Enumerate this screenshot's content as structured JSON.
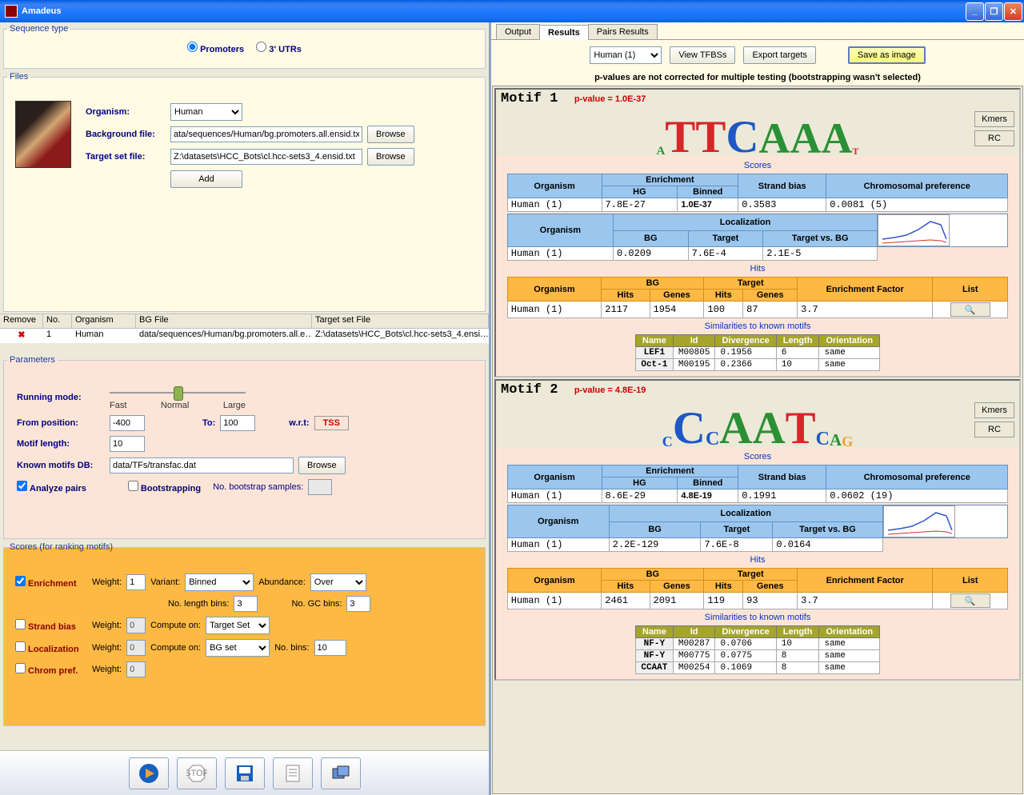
{
  "title": "Amadeus",
  "seqtype": {
    "legend": "Sequence type",
    "promoters": "Promoters",
    "utrs": "3' UTRs"
  },
  "files": {
    "legend": "Files",
    "organism_lbl": "Organism:",
    "organism_val": "Human",
    "bgfile_lbl": "Background file:",
    "bgfile_val": "ata/sequences/Human/bg.promoters.all.ensid.txt",
    "tgtfile_lbl": "Target set file:",
    "tgtfile_val": "Z:\\datasets\\HCC_Bots\\cl.hcc-sets3_4.ensid.txt",
    "browse": "Browse",
    "add": "Add"
  },
  "ftable": {
    "h": [
      "Remove",
      "No.",
      "Organism",
      "BG File",
      "Target set File"
    ],
    "row": [
      "",
      "1",
      "Human",
      "data/sequences/Human/bg.promoters.all.e…",
      "Z:\\datasets\\HCC_Bots\\cl.hcc-sets3_4.ensi…"
    ]
  },
  "params": {
    "legend": "Parameters",
    "runmode": "Running mode:",
    "fast": "Fast",
    "normal": "Normal",
    "large": "Large",
    "frompos": "From position:",
    "frompos_v": "-400",
    "to": "To:",
    "to_v": "100",
    "wrt": "w.r.t:",
    "tss": "TSS",
    "motiflen": "Motif length:",
    "motiflen_v": "10",
    "knownDB": "Known motifs DB:",
    "knownDB_v": "data/TFs/transfac.dat",
    "browse": "Browse",
    "analyze": "Analyze pairs",
    "boot": "Bootstrapping",
    "bootsamp": "No. bootstrap samples:"
  },
  "scores": {
    "legend": "Scores (for ranking motifs)",
    "enr": "Enrichment",
    "weight": "Weight:",
    "variant": "Variant:",
    "binned": "Binned",
    "abund": "Abundance:",
    "over": "Over",
    "nlen": "No. length bins:",
    "ngc": "No. GC bins:",
    "three": "3",
    "strand": "Strand bias",
    "compute": "Compute on:",
    "tgtset": "Target Set",
    "local": "Localization",
    "bgset": "BG set",
    "nobins": "No. bins:",
    "ten": "10",
    "chrom": "Chrom pref.",
    "w1": "1",
    "w0": "0"
  },
  "tabs": {
    "output": "Output",
    "results": "Results",
    "pairs": "Pairs Results"
  },
  "actions": {
    "human": "Human (1)",
    "viewtfbs": "View TFBSs",
    "export": "Export targets",
    "save": "Save as image"
  },
  "note": "p-values are not corrected for multiple testing (bootstrapping wasn't selected)",
  "motifs": [
    {
      "hdr": "Motif 1",
      "pval": "p-value = 1.0E-37",
      "logo": [
        {
          "c": "A",
          "h": 0.25,
          "col": "cA"
        },
        {
          "c": "T",
          "h": 0.95,
          "col": "cT"
        },
        {
          "c": "T",
          "h": 0.95,
          "col": "cT"
        },
        {
          "c": "C",
          "h": 0.95,
          "col": "cC"
        },
        {
          "c": "A",
          "h": 0.9,
          "col": "cA"
        },
        {
          "c": "A",
          "h": 0.9,
          "col": "cA"
        },
        {
          "c": "A",
          "h": 0.9,
          "col": "cA"
        },
        {
          "c": "T",
          "h": 0.2,
          "col": "cT"
        }
      ],
      "scores_lbl": "Scores",
      "enr": {
        "org": "Human (1)",
        "hg": "7.8E-27",
        "binned": "1.0E-37",
        "strand": "0.3583",
        "chrom": "0.0081 (5)"
      },
      "loc": {
        "org": "Human (1)",
        "bg": "0.0209",
        "tgt": "7.6E-4",
        "tvb": "2.1E-5"
      },
      "hits_lbl": "Hits",
      "hits": {
        "org": "Human (1)",
        "bghits": "2117",
        "bggenes": "1954",
        "tgthits": "100",
        "tgtgenes": "87",
        "ef": "3.7"
      },
      "sim_lbl": "Similarities to known motifs",
      "sim": [
        [
          "LEF1",
          "M00805",
          "0.1956",
          "6",
          "same"
        ],
        [
          "Oct-1",
          "M00195",
          "0.2366",
          "10",
          "same"
        ]
      ],
      "simh": [
        "Name",
        "Id",
        "Divergence",
        "Length",
        "Orientation"
      ],
      "kmers": "Kmers",
      "rc": "RC",
      "list": "List"
    },
    {
      "hdr": "Motif 2",
      "pval": "p-value = 4.8E-19",
      "logo": [
        {
          "c": "C",
          "h": 0.3,
          "col": "cC"
        },
        {
          "c": "C",
          "h": 0.95,
          "col": "cC"
        },
        {
          "c": "C",
          "h": 0.4,
          "col": "cC"
        },
        {
          "c": "A",
          "h": 0.95,
          "col": "cA"
        },
        {
          "c": "A",
          "h": 0.95,
          "col": "cA"
        },
        {
          "c": "T",
          "h": 0.95,
          "col": "cT"
        },
        {
          "c": "C",
          "h": 0.4,
          "col": "cC"
        },
        {
          "c": "A",
          "h": 0.35,
          "col": "cA"
        },
        {
          "c": "G",
          "h": 0.3,
          "col": "cG"
        }
      ],
      "scores_lbl": "Scores",
      "enr": {
        "org": "Human (1)",
        "hg": "8.6E-29",
        "binned": "4.8E-19",
        "strand": "0.1991",
        "chrom": "0.0602 (19)"
      },
      "loc": {
        "org": "Human (1)",
        "bg": "2.2E-129",
        "tgt": "7.6E-8",
        "tvb": "0.0164"
      },
      "hits_lbl": "Hits",
      "hits": {
        "org": "Human (1)",
        "bghits": "2461",
        "bggenes": "2091",
        "tgthits": "119",
        "tgtgenes": "93",
        "ef": "3.7"
      },
      "sim_lbl": "Similarities to known motifs",
      "sim": [
        [
          "NF-Y",
          "M00287",
          "0.0706",
          "10",
          "same"
        ],
        [
          "NF-Y",
          "M00775",
          "0.0775",
          "8",
          "same"
        ],
        [
          "CCAAT",
          "M00254",
          "0.1069",
          "8",
          "same"
        ]
      ],
      "simh": [
        "Name",
        "Id",
        "Divergence",
        "Length",
        "Orientation"
      ],
      "kmers": "Kmers",
      "rc": "RC",
      "list": "List"
    }
  ],
  "th": {
    "org": "Organism",
    "enr": "Enrichment",
    "hg": "HG",
    "bin": "Binned",
    "strand": "Strand bias",
    "chrom": "Chromosomal preference",
    "localiz": "Localization",
    "bg": "BG",
    "tgt": "Target",
    "tvb": "Target vs. BG",
    "hits": "Hits",
    "genes": "Genes",
    "ef": "Enrichment Factor",
    "list": "List"
  }
}
